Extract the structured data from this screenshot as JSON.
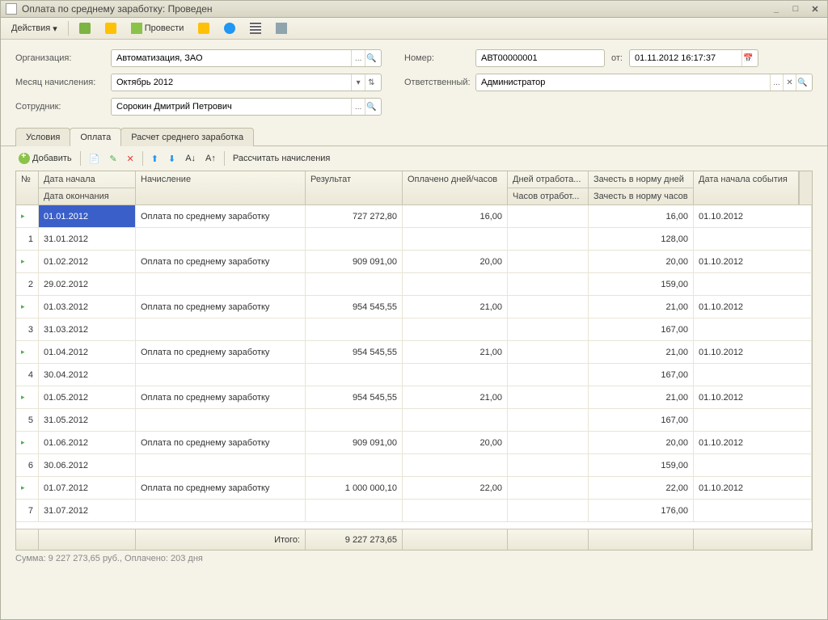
{
  "window": {
    "title": "Оплата по среднему заработку: Проведен"
  },
  "toolbar": {
    "actions": "Действия",
    "post": "Провести"
  },
  "form": {
    "org_label": "Организация:",
    "org_value": "Автоматизация, ЗАО",
    "month_label": "Месяц начисления:",
    "month_value": "Октябрь 2012",
    "emp_label": "Сотрудник:",
    "emp_value": "Сорокин Дмитрий Петрович",
    "num_label": "Номер:",
    "num_value": "АВТ00000001",
    "from_label": "от:",
    "from_value": "01.11.2012 16:17:37",
    "resp_label": "Ответственный:",
    "resp_value": "Администратор"
  },
  "tabs": {
    "t1": "Условия",
    "t2": "Оплата",
    "t3": "Расчет среднего заработка"
  },
  "subbar": {
    "add": "Добавить",
    "recalc": "Рассчитать начисления"
  },
  "headers": {
    "no": "№",
    "date_start": "Дата начала",
    "date_end": "Дата окончания",
    "calc": "Начисление",
    "result": "Результат",
    "paid": "Оплачено дней/часов",
    "days_worked": "Дней отработа...",
    "hours_worked": "Часов отработ...",
    "norm_days": "Зачесть в норму дней",
    "norm_hours": "Зачесть в норму часов",
    "event_date": "Дата начала события"
  },
  "rows": [
    {
      "n": "1",
      "ds": "01.01.2012",
      "de": "31.01.2012",
      "calc": "Оплата по среднему заработку",
      "res": "727 272,80",
      "paid": "16,00",
      "days": "",
      "norm_d": "16,00",
      "norm_h": "128,00",
      "ev": "01.10.2012"
    },
    {
      "n": "2",
      "ds": "01.02.2012",
      "de": "29.02.2012",
      "calc": "Оплата по среднему заработку",
      "res": "909 091,00",
      "paid": "20,00",
      "days": "",
      "norm_d": "20,00",
      "norm_h": "159,00",
      "ev": "01.10.2012"
    },
    {
      "n": "3",
      "ds": "01.03.2012",
      "de": "31.03.2012",
      "calc": "Оплата по среднему заработку",
      "res": "954 545,55",
      "paid": "21,00",
      "days": "",
      "norm_d": "21,00",
      "norm_h": "167,00",
      "ev": "01.10.2012"
    },
    {
      "n": "4",
      "ds": "01.04.2012",
      "de": "30.04.2012",
      "calc": "Оплата по среднему заработку",
      "res": "954 545,55",
      "paid": "21,00",
      "days": "",
      "norm_d": "21,00",
      "norm_h": "167,00",
      "ev": "01.10.2012"
    },
    {
      "n": "5",
      "ds": "01.05.2012",
      "de": "31.05.2012",
      "calc": "Оплата по среднему заработку",
      "res": "954 545,55",
      "paid": "21,00",
      "days": "",
      "norm_d": "21,00",
      "norm_h": "167,00",
      "ev": "01.10.2012"
    },
    {
      "n": "6",
      "ds": "01.06.2012",
      "de": "30.06.2012",
      "calc": "Оплата по среднему заработку",
      "res": "909 091,00",
      "paid": "20,00",
      "days": "",
      "norm_d": "20,00",
      "norm_h": "159,00",
      "ev": "01.10.2012"
    },
    {
      "n": "7",
      "ds": "01.07.2012",
      "de": "31.07.2012",
      "calc": "Оплата по среднему заработку",
      "res": "1 000 000,10",
      "paid": "22,00",
      "days": "",
      "norm_d": "22,00",
      "norm_h": "176,00",
      "ev": "01.10.2012"
    }
  ],
  "footer": {
    "total_label": "Итого:",
    "total": "9 227 273,65"
  },
  "status": "Сумма: 9 227 273,65 руб., Оплачено: 203 дня"
}
